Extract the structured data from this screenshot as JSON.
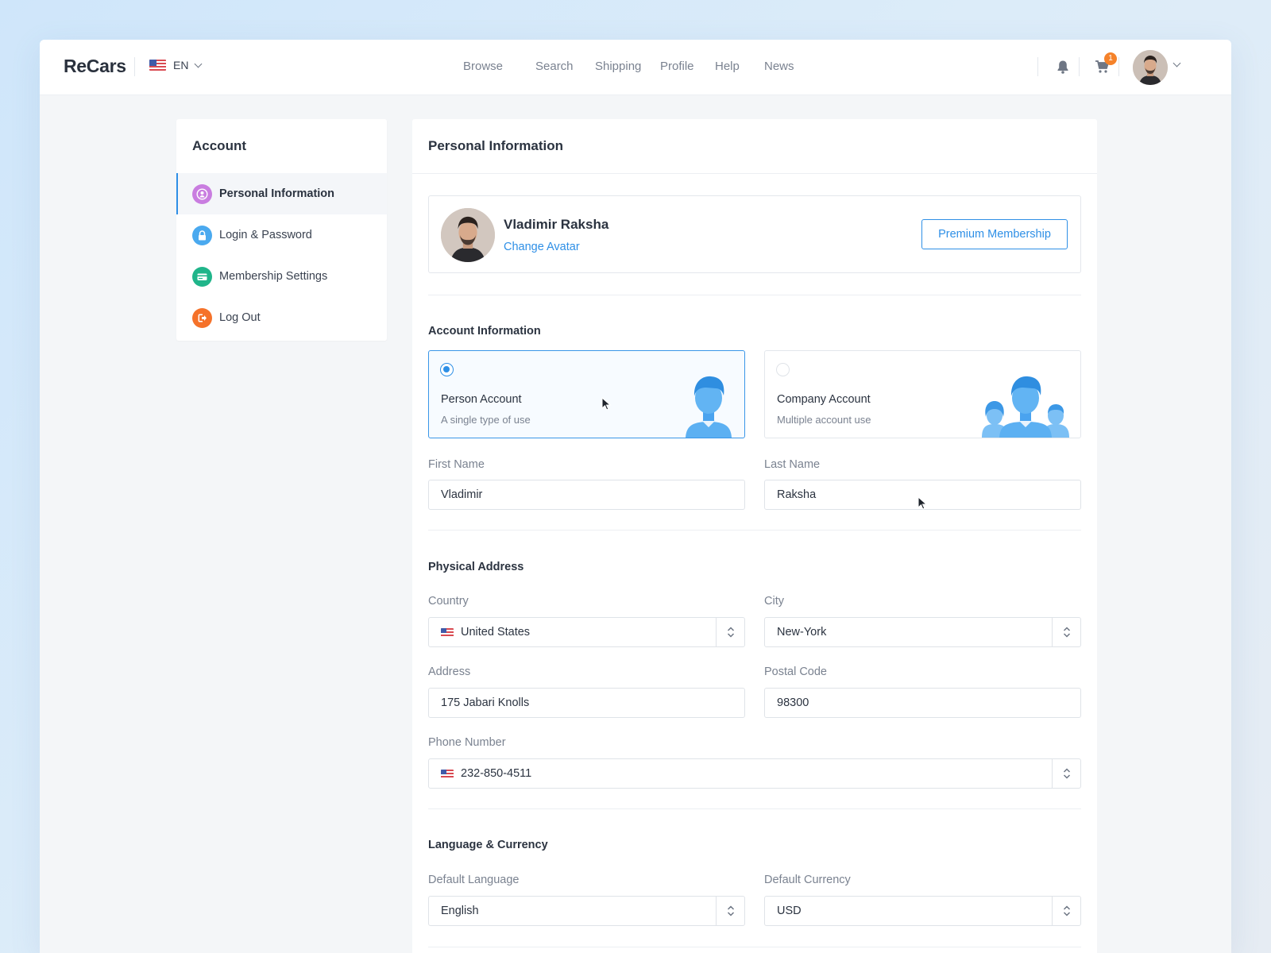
{
  "header": {
    "logo": "ReCars",
    "language": "EN",
    "nav": [
      "Browse",
      "Search",
      "Shipping",
      "Profile",
      "Help",
      "News"
    ],
    "cart_count": "1"
  },
  "sidebar": {
    "title": "Account",
    "items": [
      {
        "label": "Personal Information",
        "icon": "user-icon",
        "color": "#c97de0",
        "active": true
      },
      {
        "label": "Login & Password",
        "icon": "lock-icon",
        "color": "#4aa9ef"
      },
      {
        "label": "Membership Settings",
        "icon": "card-icon",
        "color": "#20b58a"
      },
      {
        "label": "Log Out",
        "icon": "logout-icon",
        "color": "#f5722a"
      }
    ]
  },
  "main": {
    "title": "Personal Information",
    "profile": {
      "name": "Vladimir Raksha",
      "change_avatar": "Change Avatar",
      "premium_label": "Premium Membership"
    },
    "account_info": {
      "title": "Account Information",
      "person": {
        "name": "Person Account",
        "desc": "A single type of use",
        "selected": true
      },
      "company": {
        "name": "Company Account",
        "desc": "Multiple account use",
        "selected": false
      }
    },
    "name_fields": {
      "first_label": "First Name",
      "first_value": "Vladimir",
      "last_label": "Last Name",
      "last_value": "Raksha"
    },
    "address": {
      "title": "Physical Address",
      "country_label": "Country",
      "country_value": "United States",
      "city_label": "City",
      "city_value": "New-York",
      "address_label": "Address",
      "address_value": "175 Jabari Knolls",
      "postal_label": "Postal Code",
      "postal_value": "98300",
      "phone_label": "Phone Number",
      "phone_value": "232-850-4511"
    },
    "lang_currency": {
      "title": "Language & Currency",
      "language_label": "Default Language",
      "language_value": "English",
      "currency_label": "Default Currency",
      "currency_value": "USD"
    }
  },
  "colors": {
    "accent": "#2e8fe6",
    "badge": "#f5822a",
    "illustration": "#4aa3ef"
  }
}
